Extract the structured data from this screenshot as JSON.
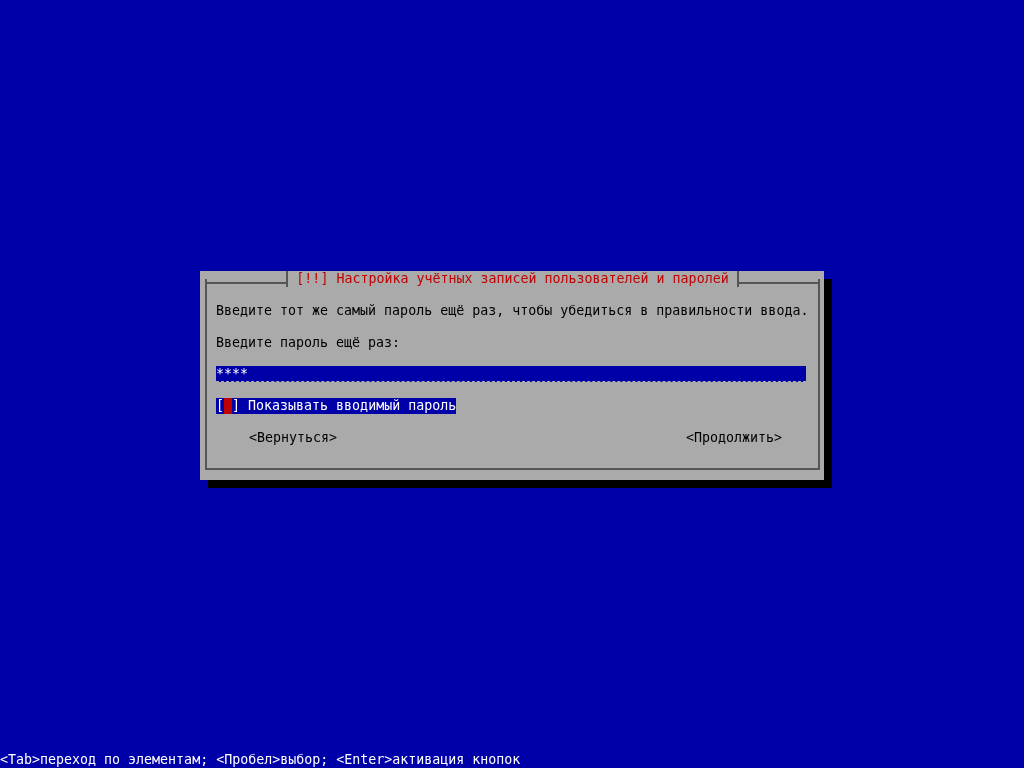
{
  "dialog": {
    "title": "[!!] Настройка учётных записей пользователей и паролей",
    "message": "Введите тот же самый пароль ещё раз, чтобы убедиться в правильности ввода.",
    "prompt": "Введите пароль ещё раз:",
    "password_field": {
      "value": "****",
      "selected": false
    },
    "checkbox": {
      "open": "[",
      "close": "]",
      "label": "Показывать вводимый пароль",
      "checked": false,
      "selected": true
    },
    "buttons": [
      {
        "label": "<Вернуться>",
        "selected": false
      },
      {
        "label": "<Продолжить>",
        "selected": false
      }
    ]
  },
  "help_line": "<Tab>переход по элементам; <Пробел>выбор; <Enter>активация кнопок"
}
